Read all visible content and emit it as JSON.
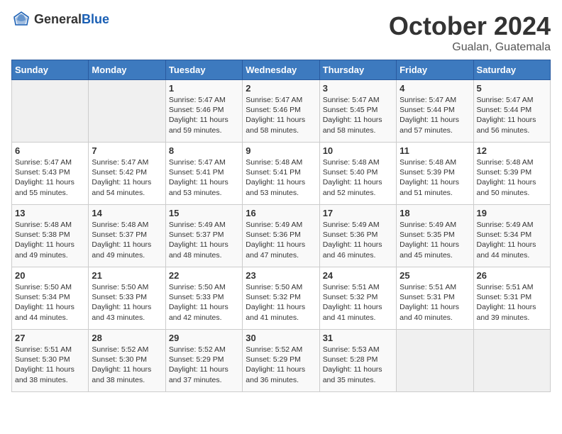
{
  "header": {
    "logo_general": "General",
    "logo_blue": "Blue",
    "month_title": "October 2024",
    "location": "Gualan, Guatemala"
  },
  "weekdays": [
    "Sunday",
    "Monday",
    "Tuesday",
    "Wednesday",
    "Thursday",
    "Friday",
    "Saturday"
  ],
  "weeks": [
    [
      {
        "day": "",
        "sunrise": "",
        "sunset": "",
        "daylight": ""
      },
      {
        "day": "",
        "sunrise": "",
        "sunset": "",
        "daylight": ""
      },
      {
        "day": "1",
        "sunrise": "Sunrise: 5:47 AM",
        "sunset": "Sunset: 5:46 PM",
        "daylight": "Daylight: 11 hours and 59 minutes."
      },
      {
        "day": "2",
        "sunrise": "Sunrise: 5:47 AM",
        "sunset": "Sunset: 5:46 PM",
        "daylight": "Daylight: 11 hours and 58 minutes."
      },
      {
        "day": "3",
        "sunrise": "Sunrise: 5:47 AM",
        "sunset": "Sunset: 5:45 PM",
        "daylight": "Daylight: 11 hours and 58 minutes."
      },
      {
        "day": "4",
        "sunrise": "Sunrise: 5:47 AM",
        "sunset": "Sunset: 5:44 PM",
        "daylight": "Daylight: 11 hours and 57 minutes."
      },
      {
        "day": "5",
        "sunrise": "Sunrise: 5:47 AM",
        "sunset": "Sunset: 5:44 PM",
        "daylight": "Daylight: 11 hours and 56 minutes."
      }
    ],
    [
      {
        "day": "6",
        "sunrise": "Sunrise: 5:47 AM",
        "sunset": "Sunset: 5:43 PM",
        "daylight": "Daylight: 11 hours and 55 minutes."
      },
      {
        "day": "7",
        "sunrise": "Sunrise: 5:47 AM",
        "sunset": "Sunset: 5:42 PM",
        "daylight": "Daylight: 11 hours and 54 minutes."
      },
      {
        "day": "8",
        "sunrise": "Sunrise: 5:47 AM",
        "sunset": "Sunset: 5:41 PM",
        "daylight": "Daylight: 11 hours and 53 minutes."
      },
      {
        "day": "9",
        "sunrise": "Sunrise: 5:48 AM",
        "sunset": "Sunset: 5:41 PM",
        "daylight": "Daylight: 11 hours and 53 minutes."
      },
      {
        "day": "10",
        "sunrise": "Sunrise: 5:48 AM",
        "sunset": "Sunset: 5:40 PM",
        "daylight": "Daylight: 11 hours and 52 minutes."
      },
      {
        "day": "11",
        "sunrise": "Sunrise: 5:48 AM",
        "sunset": "Sunset: 5:39 PM",
        "daylight": "Daylight: 11 hours and 51 minutes."
      },
      {
        "day": "12",
        "sunrise": "Sunrise: 5:48 AM",
        "sunset": "Sunset: 5:39 PM",
        "daylight": "Daylight: 11 hours and 50 minutes."
      }
    ],
    [
      {
        "day": "13",
        "sunrise": "Sunrise: 5:48 AM",
        "sunset": "Sunset: 5:38 PM",
        "daylight": "Daylight: 11 hours and 49 minutes."
      },
      {
        "day": "14",
        "sunrise": "Sunrise: 5:48 AM",
        "sunset": "Sunset: 5:37 PM",
        "daylight": "Daylight: 11 hours and 49 minutes."
      },
      {
        "day": "15",
        "sunrise": "Sunrise: 5:49 AM",
        "sunset": "Sunset: 5:37 PM",
        "daylight": "Daylight: 11 hours and 48 minutes."
      },
      {
        "day": "16",
        "sunrise": "Sunrise: 5:49 AM",
        "sunset": "Sunset: 5:36 PM",
        "daylight": "Daylight: 11 hours and 47 minutes."
      },
      {
        "day": "17",
        "sunrise": "Sunrise: 5:49 AM",
        "sunset": "Sunset: 5:36 PM",
        "daylight": "Daylight: 11 hours and 46 minutes."
      },
      {
        "day": "18",
        "sunrise": "Sunrise: 5:49 AM",
        "sunset": "Sunset: 5:35 PM",
        "daylight": "Daylight: 11 hours and 45 minutes."
      },
      {
        "day": "19",
        "sunrise": "Sunrise: 5:49 AM",
        "sunset": "Sunset: 5:34 PM",
        "daylight": "Daylight: 11 hours and 44 minutes."
      }
    ],
    [
      {
        "day": "20",
        "sunrise": "Sunrise: 5:50 AM",
        "sunset": "Sunset: 5:34 PM",
        "daylight": "Daylight: 11 hours and 44 minutes."
      },
      {
        "day": "21",
        "sunrise": "Sunrise: 5:50 AM",
        "sunset": "Sunset: 5:33 PM",
        "daylight": "Daylight: 11 hours and 43 minutes."
      },
      {
        "day": "22",
        "sunrise": "Sunrise: 5:50 AM",
        "sunset": "Sunset: 5:33 PM",
        "daylight": "Daylight: 11 hours and 42 minutes."
      },
      {
        "day": "23",
        "sunrise": "Sunrise: 5:50 AM",
        "sunset": "Sunset: 5:32 PM",
        "daylight": "Daylight: 11 hours and 41 minutes."
      },
      {
        "day": "24",
        "sunrise": "Sunrise: 5:51 AM",
        "sunset": "Sunset: 5:32 PM",
        "daylight": "Daylight: 11 hours and 41 minutes."
      },
      {
        "day": "25",
        "sunrise": "Sunrise: 5:51 AM",
        "sunset": "Sunset: 5:31 PM",
        "daylight": "Daylight: 11 hours and 40 minutes."
      },
      {
        "day": "26",
        "sunrise": "Sunrise: 5:51 AM",
        "sunset": "Sunset: 5:31 PM",
        "daylight": "Daylight: 11 hours and 39 minutes."
      }
    ],
    [
      {
        "day": "27",
        "sunrise": "Sunrise: 5:51 AM",
        "sunset": "Sunset: 5:30 PM",
        "daylight": "Daylight: 11 hours and 38 minutes."
      },
      {
        "day": "28",
        "sunrise": "Sunrise: 5:52 AM",
        "sunset": "Sunset: 5:30 PM",
        "daylight": "Daylight: 11 hours and 38 minutes."
      },
      {
        "day": "29",
        "sunrise": "Sunrise: 5:52 AM",
        "sunset": "Sunset: 5:29 PM",
        "daylight": "Daylight: 11 hours and 37 minutes."
      },
      {
        "day": "30",
        "sunrise": "Sunrise: 5:52 AM",
        "sunset": "Sunset: 5:29 PM",
        "daylight": "Daylight: 11 hours and 36 minutes."
      },
      {
        "day": "31",
        "sunrise": "Sunrise: 5:53 AM",
        "sunset": "Sunset: 5:28 PM",
        "daylight": "Daylight: 11 hours and 35 minutes."
      },
      {
        "day": "",
        "sunrise": "",
        "sunset": "",
        "daylight": ""
      },
      {
        "day": "",
        "sunrise": "",
        "sunset": "",
        "daylight": ""
      }
    ]
  ]
}
